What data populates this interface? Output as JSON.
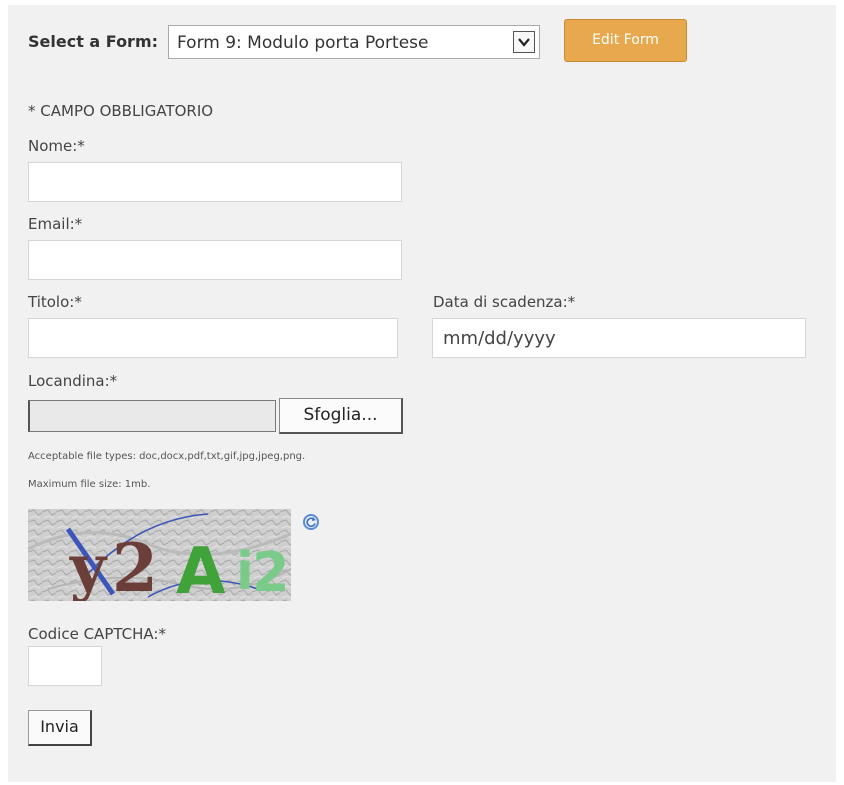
{
  "header": {
    "select_label": "Select a Form:",
    "selected_form": "Form 9: Modulo porta Portese",
    "edit_button": "Edit Form"
  },
  "form": {
    "required_note": "* CAMPO OBBLIGATORIO",
    "nome_label": "Nome:*",
    "nome_value": "",
    "email_label": "Email:*",
    "email_value": "",
    "titolo_label": "Titolo:*",
    "titolo_value": "",
    "scadenza_label": "Data di scadenza:*",
    "scadenza_placeholder": "mm/dd/yyyy",
    "locandina_label": "Locandina:*",
    "browse_button": "Sfoglia...",
    "file_types_note": "Acceptable file types: doc,docx,pdf,txt,gif,jpg,jpeg,png.",
    "file_size_note": "Maximum file size: 1mb.",
    "captcha_text": "y2Ai2",
    "captcha_label": "Codice CAPTCHA:*",
    "submit_button": "Invia"
  },
  "colors": {
    "panel_bg": "#f1f1f1",
    "edit_button_bg": "#e8a94e",
    "refresh_icon": "#5b8bd0"
  },
  "icons": {
    "dropdown": "chevron-down-icon",
    "refresh": "refresh-icon"
  }
}
